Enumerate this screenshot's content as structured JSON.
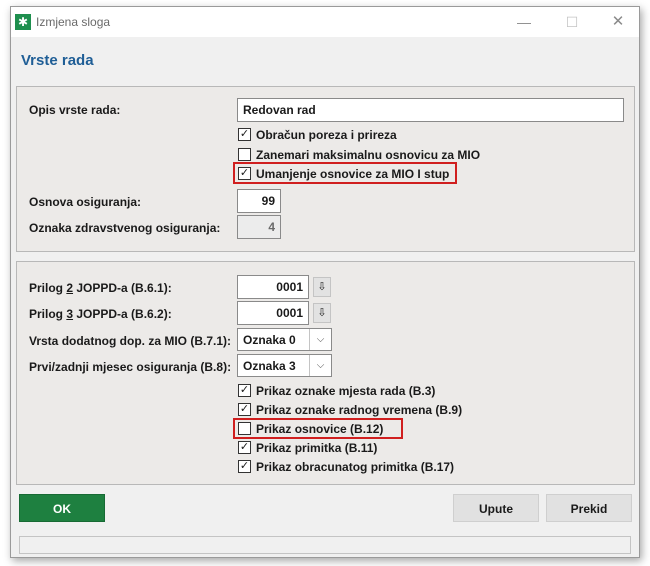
{
  "window": {
    "title": "Izmjena sloga",
    "icon": "app-star-icon",
    "minimize_glyph": "—",
    "maximize_glyph": "☐",
    "close_glyph": "✕"
  },
  "dialog": {
    "title": "Vrste rada"
  },
  "section1": {
    "opis_label": "Opis vrste rada:",
    "opis_value": "Redovan rad",
    "checkboxes": [
      {
        "label": "Obračun poreza i prireza",
        "checked": true,
        "mark": "✓"
      },
      {
        "label": "Zanemari maksimalnu osnovicu za MIO",
        "checked": false,
        "mark": ""
      },
      {
        "label": "Umanjenje osnovice za MIO I stup",
        "checked": true,
        "mark": "✓"
      }
    ],
    "osnova_label": "Osnova osiguranja:",
    "osnova_value": "99",
    "oznaka_zdr_label": "Oznaka zdravstvenog osiguranja:",
    "oznaka_zdr_value": "4"
  },
  "section2": {
    "prilog2_label_pre": "Prilog ",
    "prilog2_label_num": "2",
    "prilog2_label_post": " JOPPD-a (B.6.1):",
    "prilog2_value": "0001",
    "prilog3_label_pre": "Prilog ",
    "prilog3_label_num": "3",
    "prilog3_label_post": " JOPPD-a (B.6.2):",
    "prilog3_value": "0001",
    "download_glyph": "⇩",
    "vrsta_label": "Vrsta dodatnog dop. za MIO (B.7.1):",
    "vrsta_value": "Oznaka 0",
    "prvi_label": "Prvi/zadnji mjesec osiguranja (B.8):",
    "prvi_value": "Oznaka 3",
    "select_arrow": "⌵",
    "checkboxes": [
      {
        "label": "Prikaz oznake mjesta rada (B.3)",
        "checked": true,
        "mark": "✓"
      },
      {
        "label": "Prikaz oznake radnog vremena (B.9)",
        "checked": true,
        "mark": "✓"
      },
      {
        "label": "Prikaz osnovice (B.12)",
        "checked": false,
        "mark": ""
      },
      {
        "label": "Prikaz primitka (B.11)",
        "checked": true,
        "mark": "✓"
      },
      {
        "label": "Prikaz obracunatog primitka (B.17)",
        "checked": true,
        "mark": "✓"
      }
    ]
  },
  "buttons": {
    "ok": "OK",
    "upute": "Upute",
    "prekid": "Prekid"
  },
  "colors": {
    "accent_title": "#1f5e96",
    "ok_button": "#1e8040",
    "highlight": "#d01f1f"
  }
}
